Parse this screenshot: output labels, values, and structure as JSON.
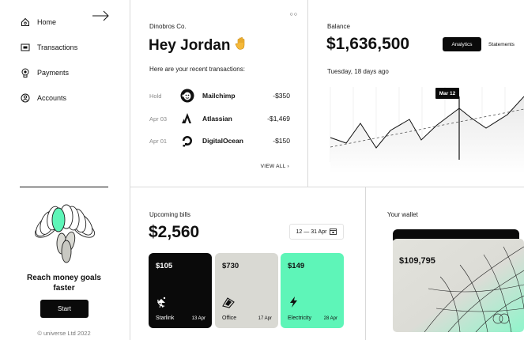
{
  "sidebar": {
    "items": [
      {
        "label": "Home",
        "icon": "home-icon"
      },
      {
        "label": "Transactions",
        "icon": "transactions-icon"
      },
      {
        "label": "Payments",
        "icon": "payments-icon"
      },
      {
        "label": "Accounts",
        "icon": "accounts-icon"
      }
    ],
    "promo_text": "Reach money goals faster",
    "start_label": "Start",
    "copyright": "© universe Ltd 2022"
  },
  "greeting": {
    "company": "Dinobros Co.",
    "title": "Hey Jordan",
    "recent_label": "Here are your recent transactions:",
    "view_all": "VIEW ALL",
    "transactions": [
      {
        "date": "Hold",
        "name": "Mailchimp",
        "amount": "-$350"
      },
      {
        "date": "Apr 03",
        "name": "Atlassian",
        "amount": "-$1,469"
      },
      {
        "date": "Apr 01",
        "name": "DigitalOcean",
        "amount": "-$150"
      }
    ]
  },
  "balance": {
    "label": "Balance",
    "amount": "$1,636,500",
    "tabs": [
      "Analytics",
      "Statements"
    ],
    "active_tab": "Analytics",
    "date_line": "Tuesday, 18 days ago",
    "marker_label": "Mar 12"
  },
  "bills": {
    "label": "Upcoming bills",
    "amount": "$2,560",
    "range": "12 — 31 Apr",
    "cards": [
      {
        "amount": "$105",
        "name": "Starlink",
        "date": "13 Apr",
        "bg": "#0a0a0a",
        "fg": "#ffffff",
        "icon": "satellite-icon"
      },
      {
        "amount": "$730",
        "name": "Office",
        "date": "17 Apr",
        "bg": "#d9d9d3",
        "fg": "#111111",
        "icon": "office-icon"
      },
      {
        "amount": "$149",
        "name": "Electricity",
        "date": "28 Apr",
        "bg": "#5ef5b8",
        "fg": "#111111",
        "icon": "electricity-icon"
      }
    ]
  },
  "wallet": {
    "label": "Your wallet",
    "card_amount": "$109,795"
  },
  "colors": {
    "accent": "#5ef5b8",
    "dark": "#0a0a0a",
    "neutral": "#d9d9d3"
  }
}
